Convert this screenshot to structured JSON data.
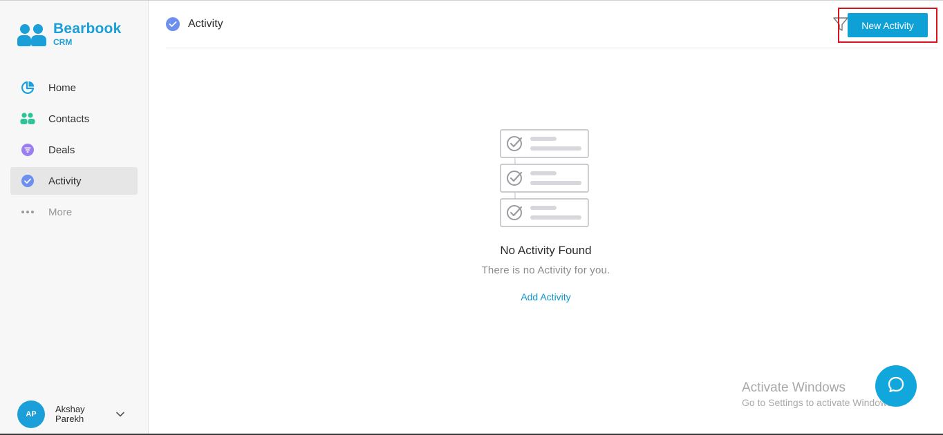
{
  "app": {
    "logo_name": "Bearbook",
    "logo_sub": "CRM"
  },
  "sidebar": {
    "items": [
      {
        "label": "Home",
        "icon": "pie-chart-icon",
        "active": false
      },
      {
        "label": "Contacts",
        "icon": "users-icon",
        "active": false
      },
      {
        "label": "Deals",
        "icon": "funnel-icon",
        "active": false
      },
      {
        "label": "Activity",
        "icon": "check-circle-icon",
        "active": true
      },
      {
        "label": "More",
        "icon": "more-dots-icon",
        "active": false
      }
    ],
    "user": {
      "initials": "AP",
      "name": "Akshay Parekh"
    }
  },
  "header": {
    "title": "Activity",
    "new_activity_label": "New Activity"
  },
  "empty_state": {
    "title": "No Activity Found",
    "subtitle": "There is no Activity for you.",
    "link_label": "Add Activity"
  },
  "watermark": {
    "title": "Activate Windows",
    "subtitle": "Go to Settings to activate Windows."
  },
  "colors": {
    "brand": "#1a9fd8",
    "button": "#0fa0d6",
    "highlight_border": "#d9131b",
    "activity_icon": "#6c8ff0",
    "contacts_icon": "#2fc39a",
    "deals_icon": "#9b7ff0"
  }
}
